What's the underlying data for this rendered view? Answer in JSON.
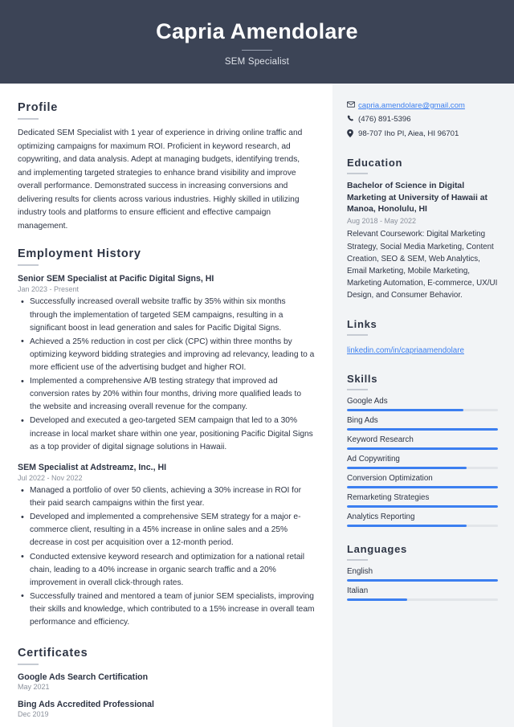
{
  "header": {
    "name": "Capria Amendolare",
    "job_title": "SEM Specialist",
    "background_color": "#3c4456"
  },
  "theme": {
    "accent_color": "#3c7ff0",
    "sidebar_background": "#f2f4f6",
    "text_color": "#2d3444",
    "muted_text_color": "#8b919c"
  },
  "main": {
    "profile": {
      "heading": "Profile",
      "text": "Dedicated SEM Specialist with 1 year of experience in driving online traffic and optimizing campaigns for maximum ROI. Proficient in keyword research, ad copywriting, and data analysis. Adept at managing budgets, identifying trends, and implementing targeted strategies to enhance brand visibility and improve overall performance. Demonstrated success in increasing conversions and delivering results for clients across various industries. Highly skilled in utilizing industry tools and platforms to ensure efficient and effective campaign management."
    },
    "employment": {
      "heading": "Employment History",
      "jobs": [
        {
          "title": "Senior SEM Specialist at Pacific Digital Signs, HI",
          "dates": "Jan 2023 - Present",
          "bullets": [
            "Successfully increased overall website traffic by 35% within six months through the implementation of targeted SEM campaigns, resulting in a significant boost in lead generation and sales for Pacific Digital Signs.",
            "Achieved a 25% reduction in cost per click (CPC) within three months by optimizing keyword bidding strategies and improving ad relevancy, leading to a more efficient use of the advertising budget and higher ROI.",
            "Implemented a comprehensive A/B testing strategy that improved ad conversion rates by 20% within four months, driving more qualified leads to the website and increasing overall revenue for the company.",
            "Developed and executed a geo-targeted SEM campaign that led to a 30% increase in local market share within one year, positioning Pacific Digital Signs as a top provider of digital signage solutions in Hawaii."
          ]
        },
        {
          "title": "SEM Specialist at Adstreamz, Inc., HI",
          "dates": "Jul 2022 - Nov 2022",
          "bullets": [
            "Managed a portfolio of over 50 clients, achieving a 30% increase in ROI for their paid search campaigns within the first year.",
            "Developed and implemented a comprehensive SEM strategy for a major e-commerce client, resulting in a 45% increase in online sales and a 25% decrease in cost per acquisition over a 12-month period.",
            "Conducted extensive keyword research and optimization for a national retail chain, leading to a 40% increase in organic search traffic and a 20% improvement in overall click-through rates.",
            "Successfully trained and mentored a team of junior SEM specialists, improving their skills and knowledge, which contributed to a 15% increase in overall team performance and efficiency."
          ]
        }
      ]
    },
    "certificates": {
      "heading": "Certificates",
      "items": [
        {
          "name": "Google Ads Search Certification",
          "date": "May 2021"
        },
        {
          "name": "Bing Ads Accredited Professional",
          "date": "Dec 2019"
        }
      ]
    }
  },
  "sidebar": {
    "contact": {
      "email": "capria.amendolare@gmail.com",
      "phone": "(476) 891-5396",
      "address": "98-707 Iho Pl, Aiea, HI 96701"
    },
    "education": {
      "heading": "Education",
      "degree": "Bachelor of Science in Digital Marketing at University of Hawaii at Manoa, Honolulu, HI",
      "dates": "Aug 2018 - May 2022",
      "description": "Relevant Coursework: Digital Marketing Strategy, Social Media Marketing, Content Creation, SEO & SEM, Web Analytics, Email Marketing, Mobile Marketing, Marketing Automation, E-commerce, UX/UI Design, and Consumer Behavior."
    },
    "links": {
      "heading": "Links",
      "items": [
        {
          "label": "linkedin.com/in/capriaamendolare"
        }
      ]
    },
    "skills": {
      "heading": "Skills",
      "items": [
        {
          "label": "Google Ads",
          "level": 77
        },
        {
          "label": "Bing Ads",
          "level": 100
        },
        {
          "label": "Keyword Research",
          "level": 100
        },
        {
          "label": "Ad Copywriting",
          "level": 79
        },
        {
          "label": "Conversion Optimization",
          "level": 100
        },
        {
          "label": "Remarketing Strategies",
          "level": 100
        },
        {
          "label": "Analytics Reporting",
          "level": 79
        }
      ]
    },
    "languages": {
      "heading": "Languages",
      "items": [
        {
          "label": "English",
          "level": 100
        },
        {
          "label": "Italian",
          "level": 40
        }
      ]
    }
  }
}
